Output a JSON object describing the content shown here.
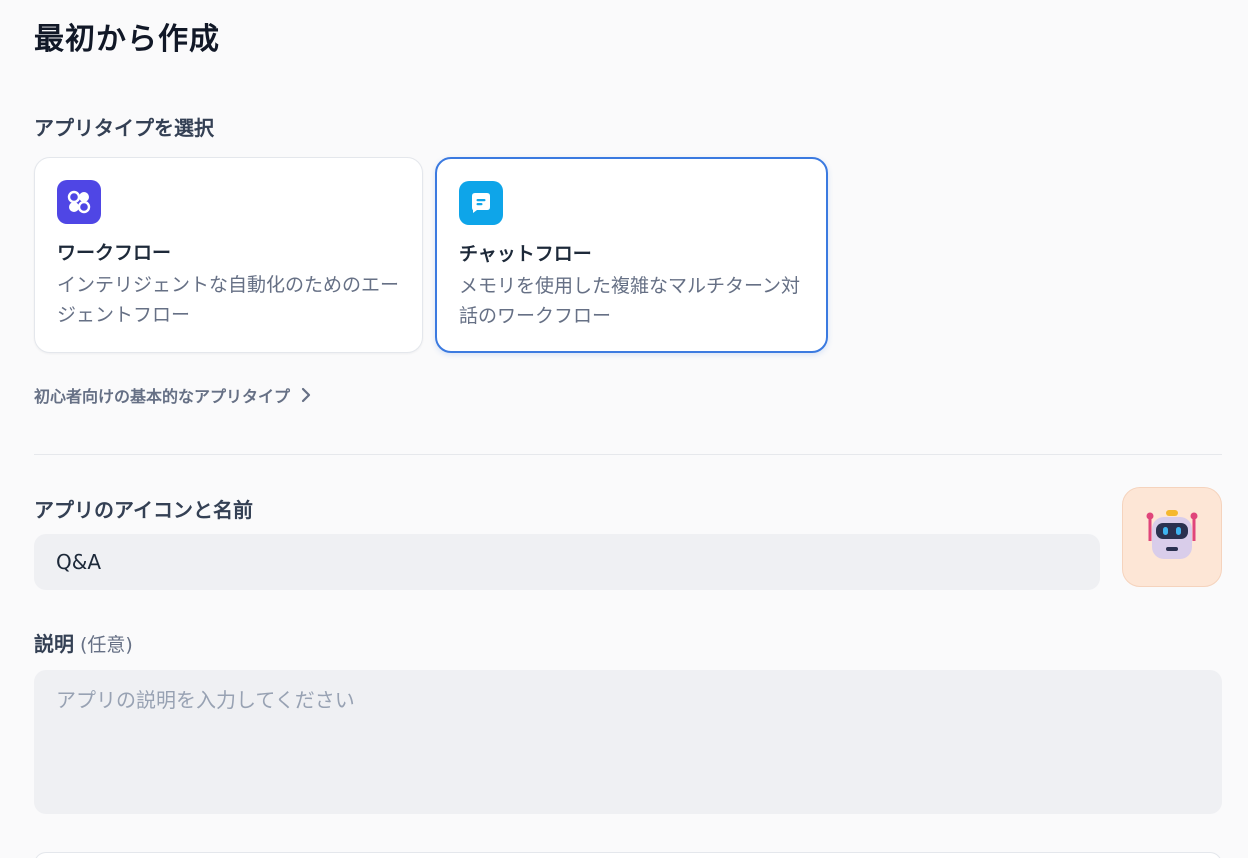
{
  "page_title": "最初から作成",
  "app_type": {
    "label": "アプリタイプを選択",
    "cards": [
      {
        "title": "ワークフロー",
        "description": "インテリジェントな自動化のためのエージェントフロー",
        "icon": "workflow-icon",
        "icon_color": "#4f46e5",
        "selected": false
      },
      {
        "title": "チャットフロー",
        "description": "メモリを使用した複雑なマルチターン対話のワークフロー",
        "icon": "chatflow-icon",
        "icon_color": "#0ea5e9",
        "selected": true
      }
    ],
    "beginner_link": "初心者向けの基本的なアプリタイプ"
  },
  "app_name": {
    "label": "アプリのアイコンと名前",
    "value": "Q&A",
    "avatar_icon": "robot-icon"
  },
  "description": {
    "label": "説明",
    "optional": "(任意)",
    "placeholder": "アプリの説明を入力してください",
    "value": ""
  },
  "colors": {
    "accent": "#3b7ae0",
    "input_bg": "#eff0f3",
    "avatar_bg": "#fde6d6"
  }
}
